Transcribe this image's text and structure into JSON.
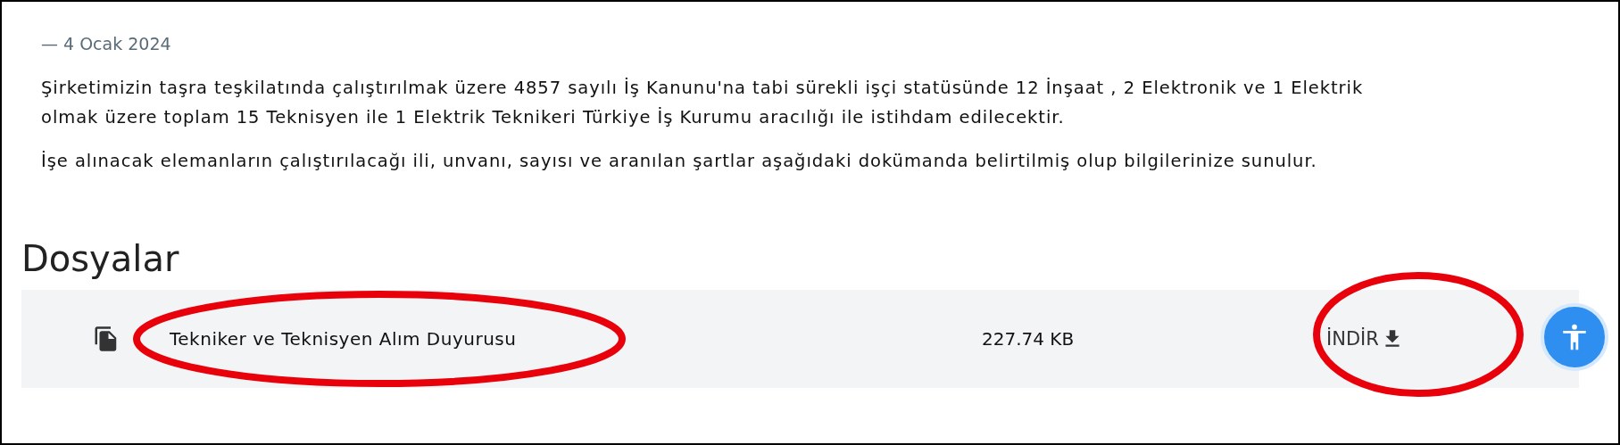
{
  "date": "— 4 Ocak 2024",
  "paragraphs": [
    [
      "Şirketimizin taşra teşkilatında çalıştırılmak üzere 4857 sayılı İş Kanunu'na tabi sürekli işçi statüsünde 12 İnşaat , 2 Elektronik ve 1 Elektrik",
      "olmak üzere toplam 15 Teknisyen ile 1 Elektrik Teknikeri Türkiye İş Kurumu aracılığı ile istihdam edilecektir."
    ],
    [
      "İşe alınacak elemanların çalıştırılacağı ili, unvanı, sayısı ve aranılan şartlar aşağıdaki dokümanda belirtilmiş olup bilgilerinize sunulur."
    ]
  ],
  "files_heading": "Dosyalar",
  "files": [
    {
      "name": "Tekniker ve Teknisyen Alım Duyurusu",
      "size": "227.74 KB",
      "download": "İNDİR"
    }
  ]
}
